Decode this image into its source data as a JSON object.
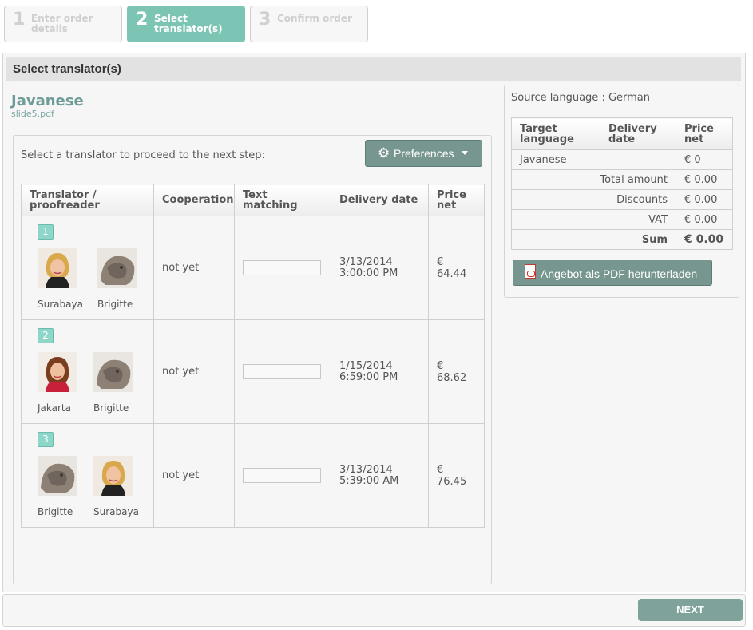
{
  "steps": [
    {
      "num": "1",
      "label": "Enter order details",
      "active": false
    },
    {
      "num": "2",
      "label": "Select translator(s)",
      "active": true
    },
    {
      "num": "3",
      "label": "Confirm order",
      "active": false
    }
  ],
  "section_title": "Select translator(s)",
  "language": "Javanese",
  "file_name": "slide5.pdf",
  "instruction": "Select a translator to proceed to the next step:",
  "preferences_label": "Preferences",
  "table": {
    "headers": [
      "Translator / proofreader",
      "Cooperation",
      "Text matching",
      "Delivery date",
      "Price net"
    ],
    "rows": [
      {
        "rank": "1",
        "people": [
          {
            "name": "Surabaya",
            "avatar": "woman-blonde"
          },
          {
            "name": "Brigitte",
            "avatar": "statue-lion"
          }
        ],
        "cooperation": "not yet",
        "delivery_date": "3/13/2014",
        "delivery_time": "3:00:00 PM",
        "price": "€ 64.44"
      },
      {
        "rank": "2",
        "people": [
          {
            "name": "Jakarta",
            "avatar": "woman-brunette"
          },
          {
            "name": "Brigitte",
            "avatar": "statue-lion"
          }
        ],
        "cooperation": "not yet",
        "delivery_date": "1/15/2014",
        "delivery_time": "6:59:00 PM",
        "price": "€ 68.62"
      },
      {
        "rank": "3",
        "people": [
          {
            "name": "Brigitte",
            "avatar": "statue-lion"
          },
          {
            "name": "Surabaya",
            "avatar": "woman-blonde"
          }
        ],
        "cooperation": "not yet",
        "delivery_date": "3/13/2014",
        "delivery_time": "5:39:00 AM",
        "price": "€ 76.45"
      }
    ]
  },
  "summary": {
    "source_language": "Source language : German",
    "headers": [
      "Target language",
      "Delivery date",
      "Price net"
    ],
    "row": {
      "target_language": "Javanese",
      "delivery_date": "",
      "price": "€ 0"
    },
    "totals": [
      {
        "label": "Total amount",
        "value": "€ 0.00"
      },
      {
        "label": "Discounts",
        "value": "€ 0.00"
      },
      {
        "label": "VAT",
        "value": "€ 0.00"
      },
      {
        "label": "Sum",
        "value": "€ 0.00"
      }
    ],
    "pdf_button": "Angebot als PDF herunterladen"
  },
  "next_button": "NEXT",
  "colors": {
    "accent": "#7cc4b3",
    "button": "#76968f",
    "title": "#6f9c98"
  }
}
